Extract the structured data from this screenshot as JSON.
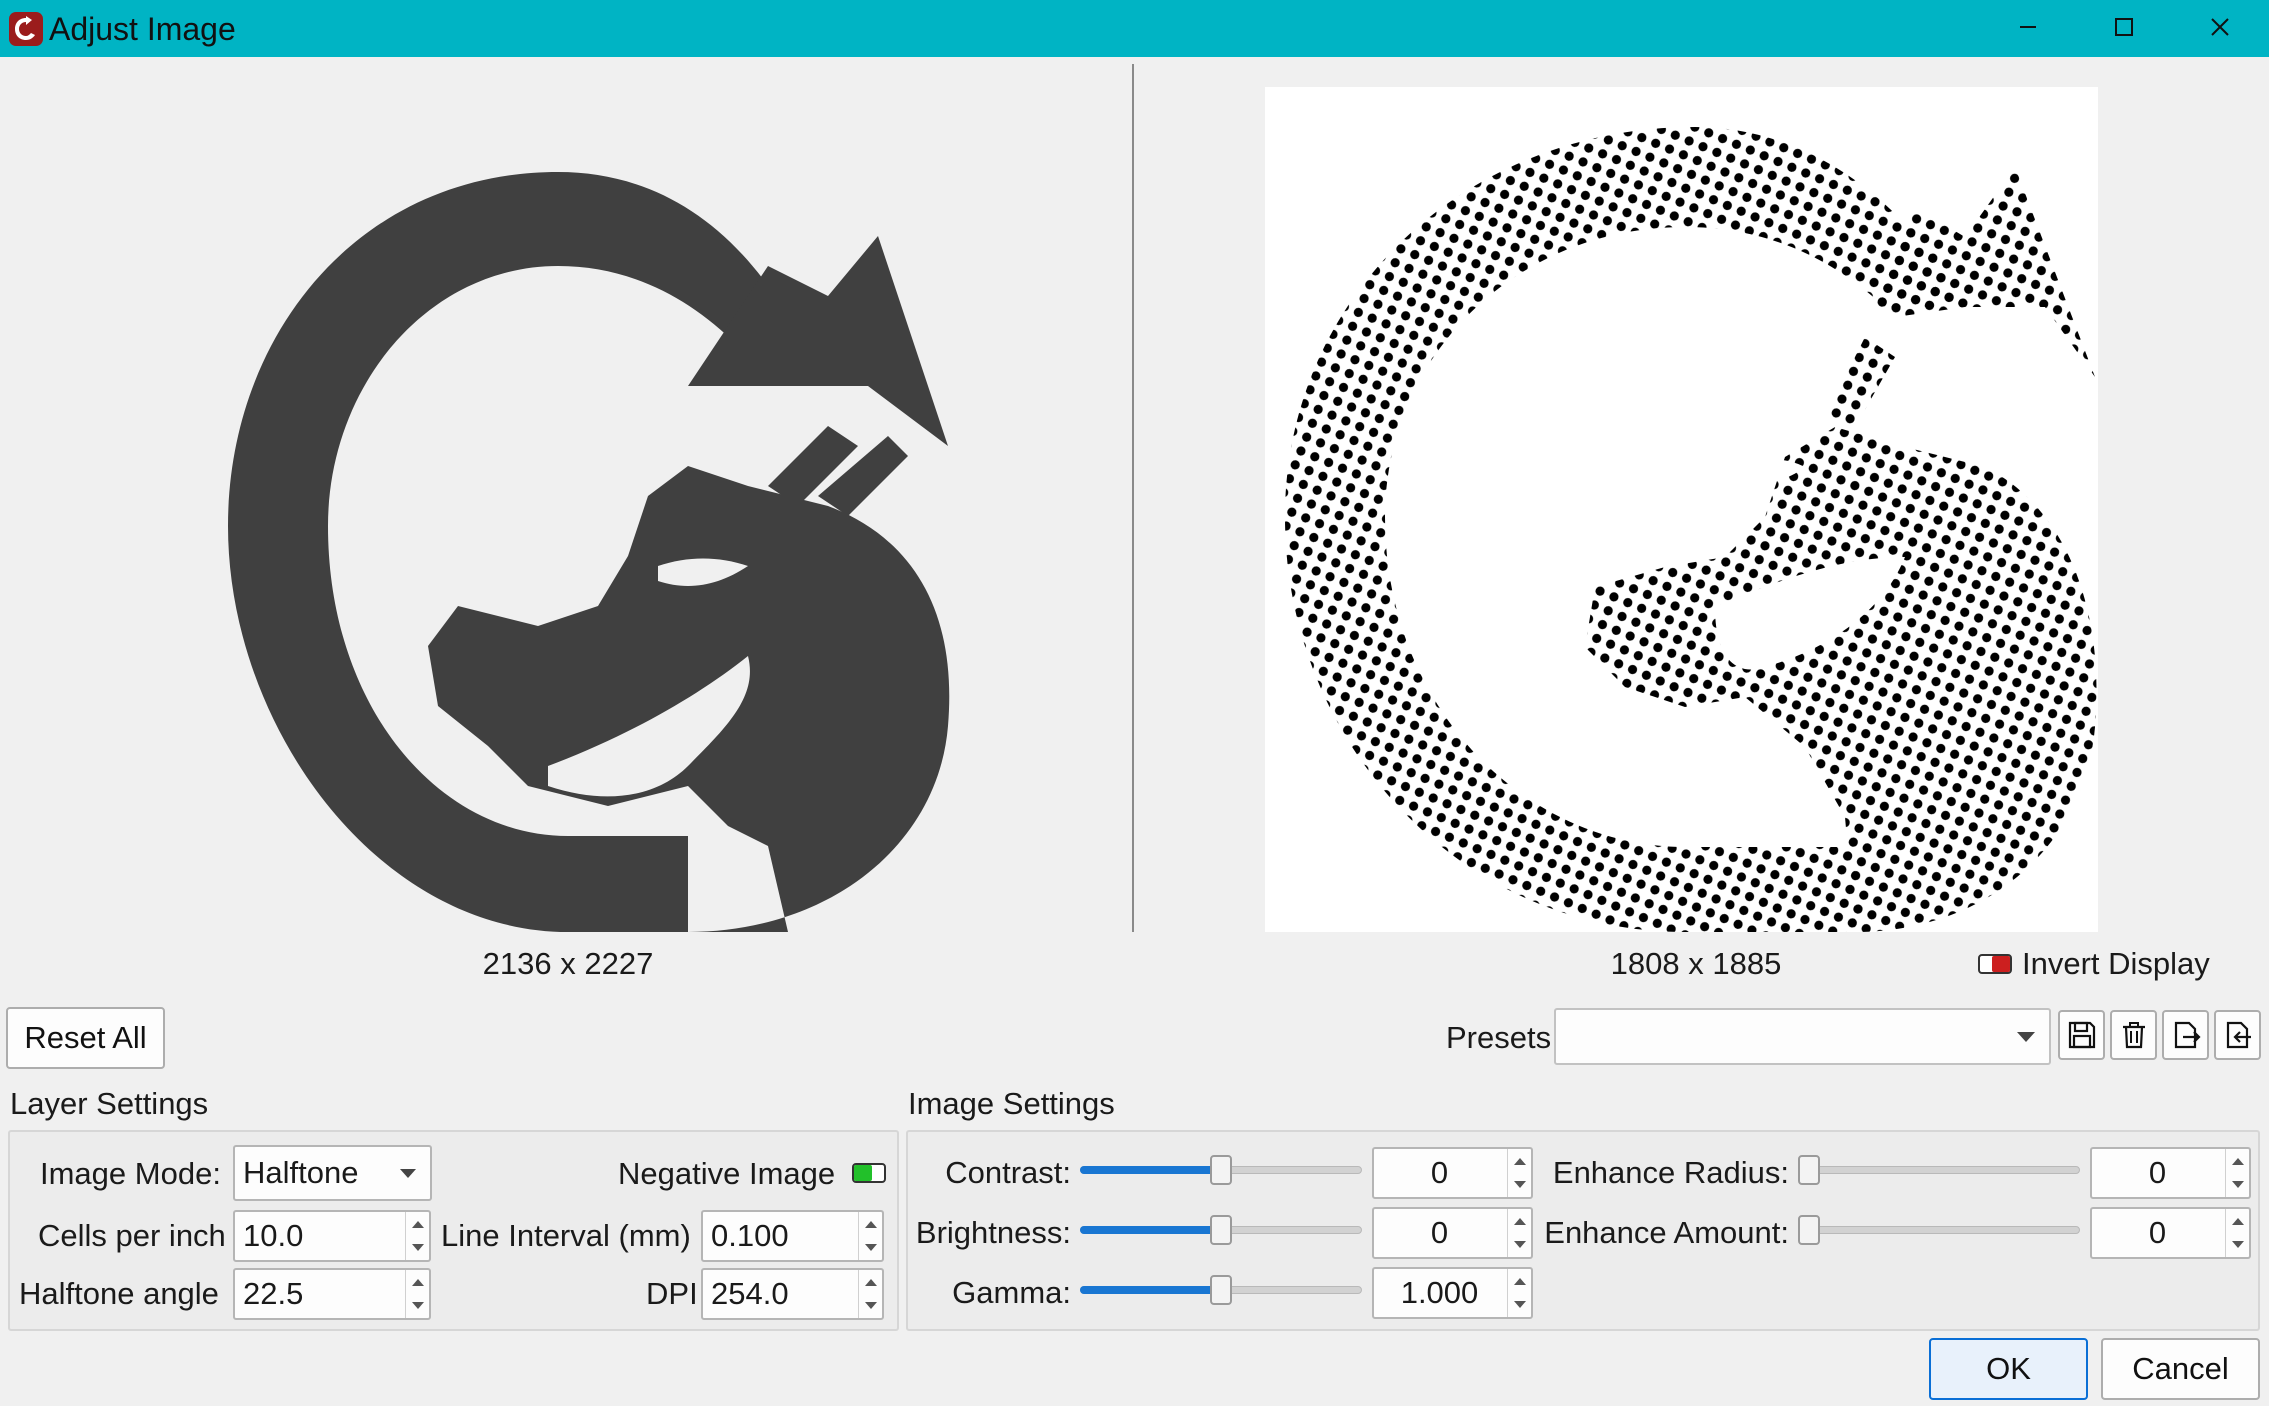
{
  "window": {
    "title": "Adjust Image"
  },
  "preview": {
    "original_size": "2136 x 2227",
    "processed_size": "1808 x 1885",
    "invert_display_label": "Invert Display",
    "invert_display_on": false
  },
  "toolbar": {
    "reset_all": "Reset All",
    "presets_label": "Presets",
    "presets_value": ""
  },
  "layer_settings": {
    "title": "Layer Settings",
    "image_mode_label": "Image Mode:",
    "image_mode_value": "Halftone",
    "negative_image_label": "Negative Image",
    "negative_image_on": true,
    "cells_per_inch_label": "Cells per inch",
    "cells_per_inch_value": "10.0",
    "line_interval_label": "Line Interval (mm)",
    "line_interval_value": "0.100",
    "halftone_angle_label": "Halftone angle",
    "halftone_angle_value": "22.5",
    "dpi_label": "DPI",
    "dpi_value": "254.0"
  },
  "image_settings": {
    "title": "Image Settings",
    "contrast_label": "Contrast:",
    "contrast_value": "0",
    "contrast_level": 0.5,
    "brightness_label": "Brightness:",
    "brightness_value": "0",
    "brightness_level": 0.5,
    "gamma_label": "Gamma:",
    "gamma_value": "1.000",
    "gamma_level": 0.5,
    "enhance_radius_label": "Enhance Radius:",
    "enhance_radius_value": "0",
    "enhance_radius_level": 0,
    "enhance_amount_label": "Enhance Amount:",
    "enhance_amount_value": "0",
    "enhance_amount_level": 0
  },
  "footer": {
    "ok": "OK",
    "cancel": "Cancel"
  },
  "colors": {
    "titlebar": "#00b4c4",
    "accent": "#1976d2",
    "logo": "#404040"
  }
}
